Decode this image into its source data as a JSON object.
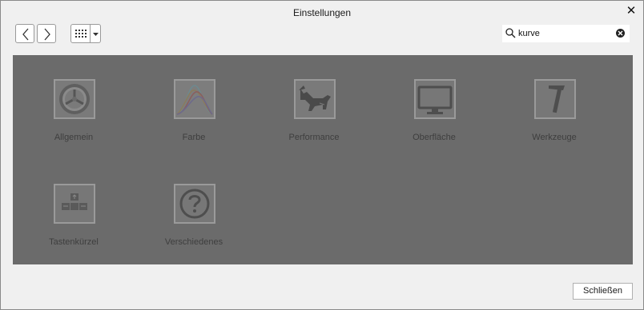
{
  "window": {
    "title": "Einstellungen"
  },
  "toolbar": {
    "back_icon": "chevron-left-icon",
    "forward_icon": "chevron-right-icon",
    "grid_icon": "grid-view-icon",
    "dropdown_icon": "caret-down-icon"
  },
  "search": {
    "value": "kurve",
    "icon": "search-icon",
    "clear_icon": "clear-icon"
  },
  "categories": [
    {
      "label": "Allgemein",
      "icon": "gear-icon"
    },
    {
      "label": "Farbe",
      "icon": "color-curve-icon"
    },
    {
      "label": "Performance",
      "icon": "cat-icon"
    },
    {
      "label": "Oberfläche",
      "icon": "monitor-icon"
    },
    {
      "label": "Werkzeuge",
      "icon": "hammer-icon"
    },
    {
      "label": "Tastenkürzel",
      "icon": "keyboard-icon"
    },
    {
      "label": "Verschiedenes",
      "icon": "question-icon"
    }
  ],
  "footer": {
    "close_label": "Schließen"
  },
  "colors": {
    "panel_overlay": "#6b6b6b",
    "window_bg": "#f0f0f0"
  }
}
